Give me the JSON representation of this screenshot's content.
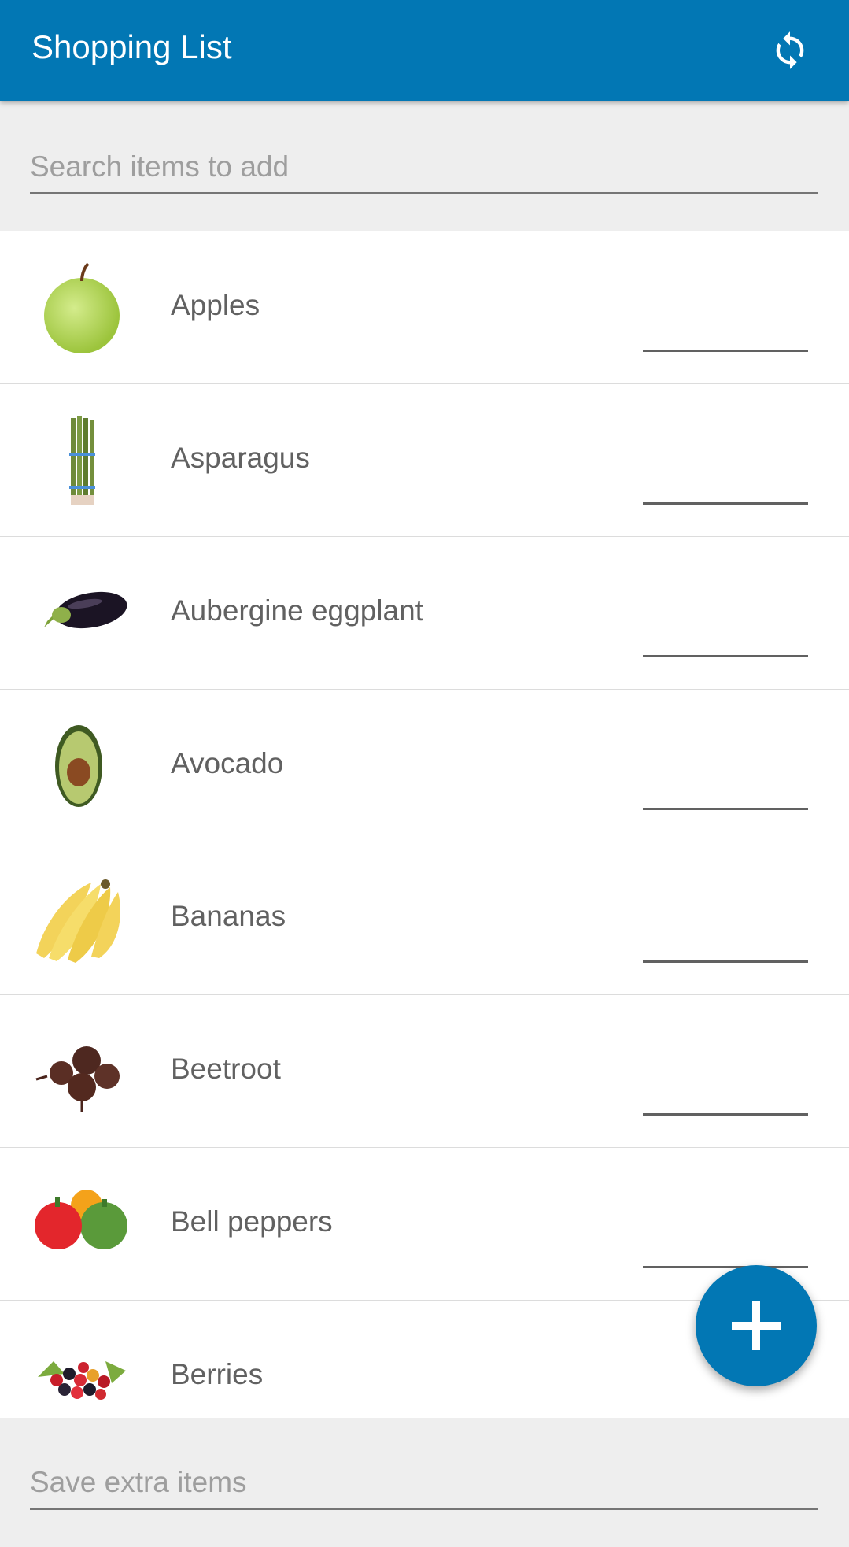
{
  "appbar": {
    "title": "Shopping List",
    "sync_icon": "sync-icon",
    "color": "#0277b4"
  },
  "search": {
    "placeholder": "Search items to add",
    "value": ""
  },
  "items": [
    {
      "label": "Apples",
      "icon": "apple-image",
      "quantity": ""
    },
    {
      "label": "Asparagus",
      "icon": "asparagus-image",
      "quantity": ""
    },
    {
      "label": "Aubergine eggplant",
      "icon": "eggplant-image",
      "quantity": ""
    },
    {
      "label": "Avocado",
      "icon": "avocado-image",
      "quantity": ""
    },
    {
      "label": "Bananas",
      "icon": "bananas-image",
      "quantity": ""
    },
    {
      "label": "Beetroot",
      "icon": "beetroot-image",
      "quantity": ""
    },
    {
      "label": "Bell peppers",
      "icon": "bell-peppers-image",
      "quantity": ""
    },
    {
      "label": "Berries",
      "icon": "berries-image",
      "quantity": ""
    }
  ],
  "fab": {
    "icon": "plus-icon"
  },
  "extra": {
    "placeholder": "Save extra items",
    "value": ""
  }
}
